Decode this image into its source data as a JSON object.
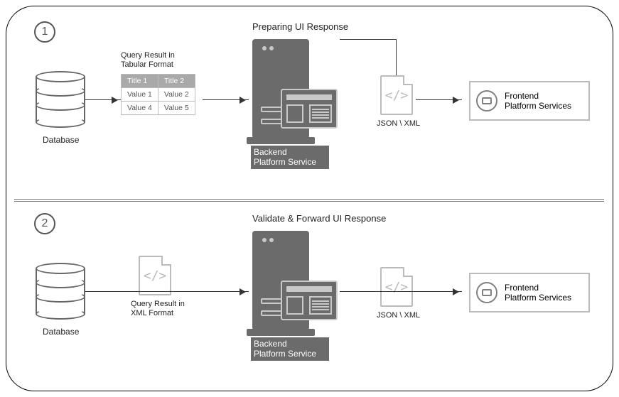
{
  "step1": {
    "number": "1",
    "db_label": "Database",
    "table_caption": "Query Result in\nTabular Format",
    "table": {
      "headers": [
        "Title 1",
        "Title 2"
      ],
      "rows": [
        [
          "Value 1",
          "Value 2"
        ],
        [
          "Value 4",
          "Value 5"
        ]
      ]
    },
    "server_heading": "Preparing UI Response",
    "server_label": "Backend\nPlatform Service",
    "file_glyph": "</>",
    "file_label": "JSON \\ XML",
    "frontend_label": "Frontend\nPlatform Services"
  },
  "step2": {
    "number": "2",
    "db_label": "Database",
    "midfile_glyph": "</>",
    "midfile_label": "Query Result in\nXML Format",
    "server_heading": "Validate & Forward UI Response",
    "server_label": "Backend\nPlatform Service",
    "file_glyph": "</>",
    "file_label": "JSON \\ XML",
    "frontend_label": "Frontend\nPlatform Services"
  }
}
